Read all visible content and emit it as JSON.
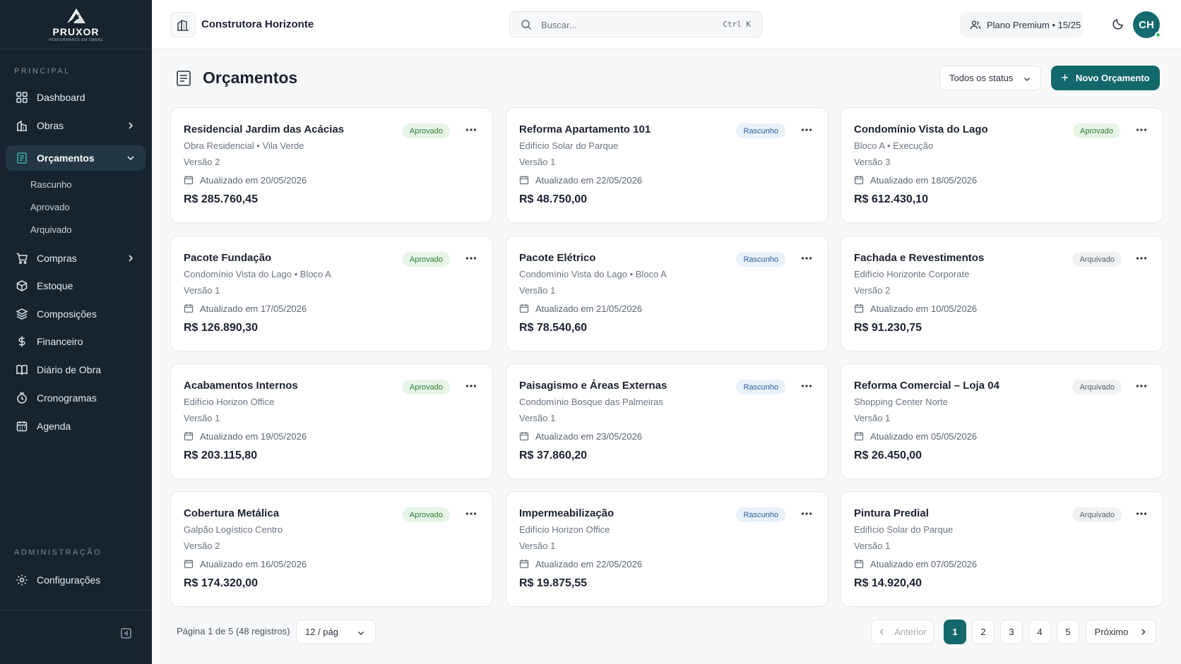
{
  "brand": {
    "name": "PRUXOR",
    "tagline": "PERFORMANCE EM OBRAS"
  },
  "sidebar": {
    "principal_label": "PRINCIPAL",
    "admin_label": "ADMINISTRAÇÃO",
    "items": [
      {
        "label": "Dashboard",
        "icon": "grid-icon"
      },
      {
        "label": "Obras",
        "icon": "building-icon"
      },
      {
        "label": "Orçamentos",
        "icon": "document-icon",
        "active": true
      },
      {
        "label": "Compras",
        "icon": "cart-icon"
      },
      {
        "label": "Estoque",
        "icon": "box-icon"
      },
      {
        "label": "Composições",
        "icon": "layers-icon"
      },
      {
        "label": "Financeiro",
        "icon": "dollar-icon"
      },
      {
        "label": "Diário de Obra",
        "icon": "book-icon"
      },
      {
        "label": "Cronogramas",
        "icon": "clock-icon"
      },
      {
        "label": "Agenda",
        "icon": "calendar-icon"
      }
    ],
    "subitems": [
      "Rascunho",
      "Aprovado",
      "Arquivado"
    ],
    "settings_label": "Configurações"
  },
  "topbar": {
    "company": "Construtora Horizonte",
    "search_placeholder": "Buscar...",
    "search_shortcut": "Ctrl K",
    "plan": "Plano Premium • 15/25",
    "avatar_initials": "CH"
  },
  "page": {
    "title": "Orçamentos",
    "status_filter": "Todos os status",
    "new_button": "Novo Orçamento"
  },
  "cards": [
    {
      "title": "Residencial Jardim das Acácias",
      "subtitle": "Obra Residencial • Vila Verde",
      "version": "Versão 2",
      "updated": "Atualizado em 20/05/2026",
      "amount": "R$ 285.760,45",
      "status": "Aprovado",
      "status_key": "aprovado"
    },
    {
      "title": "Reforma Apartamento 101",
      "subtitle": "Edifício Solar do Parque",
      "version": "Versão 1",
      "updated": "Atualizado em 22/05/2026",
      "amount": "R$ 48.750,00",
      "status": "Rascunho",
      "status_key": "rascunho"
    },
    {
      "title": "Condomínio Vista do Lago",
      "subtitle": "Bloco A • Execução",
      "version": "Versão 3",
      "updated": "Atualizado em 18/05/2026",
      "amount": "R$ 612.430,10",
      "status": "Aprovado",
      "status_key": "aprovado"
    },
    {
      "title": "Pacote Fundação",
      "subtitle": "Condomínio Vista do Lago • Bloco A",
      "version": "Versão 1",
      "updated": "Atualizado em 17/05/2026",
      "amount": "R$ 126.890,30",
      "status": "Aprovado",
      "status_key": "aprovado"
    },
    {
      "title": "Pacote Elétrico",
      "subtitle": "Condomínio Vista do Lago • Bloco A",
      "version": "Versão 1",
      "updated": "Atualizado em 21/05/2026",
      "amount": "R$ 78.540,60",
      "status": "Rascunho",
      "status_key": "rascunho"
    },
    {
      "title": "Fachada e Revestimentos",
      "subtitle": "Edifício Horizonte Corporate",
      "version": "Versão 2",
      "updated": "Atualizado em 10/05/2026",
      "amount": "R$ 91.230,75",
      "status": "Arquivado",
      "status_key": "arquivado"
    },
    {
      "title": "Acabamentos Internos",
      "subtitle": "Edifício Horizon Office",
      "version": "Versão 1",
      "updated": "Atualizado em 19/05/2026",
      "amount": "R$ 203.115,80",
      "status": "Aprovado",
      "status_key": "aprovado"
    },
    {
      "title": "Paisagismo e Áreas Externas",
      "subtitle": "Condomínio Bosque das Palmeiras",
      "version": "Versão 1",
      "updated": "Atualizado em 23/05/2026",
      "amount": "R$ 37.860,20",
      "status": "Rascunho",
      "status_key": "rascunho"
    },
    {
      "title": "Reforma Comercial – Loja 04",
      "subtitle": "Shopping Center Norte",
      "version": "Versão 1",
      "updated": "Atualizado em 05/05/2026",
      "amount": "R$ 26.450,00",
      "status": "Arquivado",
      "status_key": "arquivado"
    },
    {
      "title": "Cobertura Metálica",
      "subtitle": "Galpão Logístico Centro",
      "version": "Versão 2",
      "updated": "Atualizado em 16/05/2026",
      "amount": "R$ 174.320,00",
      "status": "Aprovado",
      "status_key": "aprovado"
    },
    {
      "title": "Impermeabilização",
      "subtitle": "Edifício Horizon Office",
      "version": "Versão 1",
      "updated": "Atualizado em 22/05/2026",
      "amount": "R$ 19.875,55",
      "status": "Rascunho",
      "status_key": "rascunho"
    },
    {
      "title": "Pintura Predial",
      "subtitle": "Edifício Solar do Parque",
      "version": "Versão 1",
      "updated": "Atualizado em 07/05/2026",
      "amount": "R$ 14.920,40",
      "status": "Arquivado",
      "status_key": "arquivado"
    }
  ],
  "pagination": {
    "info": "Página 1 de 5 (48 registros)",
    "per_page": "12 / pág",
    "prev": "Anterior",
    "next": "Próximo",
    "pages": [
      "1",
      "2",
      "3",
      "4",
      "5"
    ],
    "current": "1"
  },
  "colors": {
    "accent": "#13686c",
    "sidebar_bg": "#17242f"
  }
}
